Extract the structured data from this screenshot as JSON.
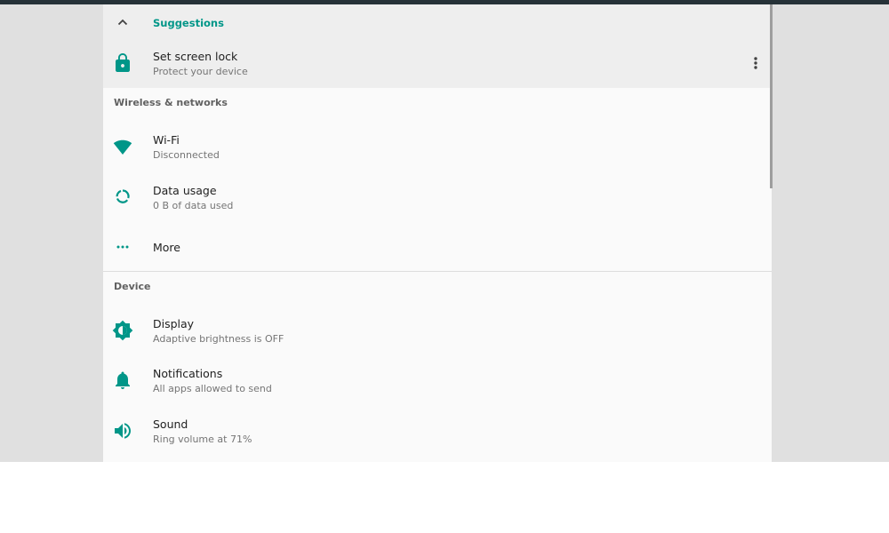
{
  "suggestions": {
    "header": "Suggestions",
    "collapse_icon": "chevron-up-icon",
    "item": {
      "icon": "lock-icon",
      "title": "Set screen lock",
      "subtitle": "Protect your device",
      "menu_icon": "more-vert-icon"
    }
  },
  "sections": {
    "wireless": {
      "title": "Wireless & networks",
      "items": [
        {
          "icon": "wifi-icon",
          "title": "Wi-Fi",
          "subtitle": "Disconnected"
        },
        {
          "icon": "data-usage-icon",
          "title": "Data usage",
          "subtitle": "0 B of data used"
        },
        {
          "icon": "more-horiz-icon",
          "title": "More"
        }
      ]
    },
    "device": {
      "title": "Device",
      "items": [
        {
          "icon": "brightness-icon",
          "title": "Display",
          "subtitle": "Adaptive brightness is OFF"
        },
        {
          "icon": "bell-icon",
          "title": "Notifications",
          "subtitle": "All apps allowed to send"
        },
        {
          "icon": "volume-icon",
          "title": "Sound",
          "subtitle": "Ring volume at 71%"
        }
      ]
    }
  },
  "colors": {
    "accent": "#009688",
    "panel": "#fafafa",
    "suggestion_bg": "#eeeeee",
    "backdrop": "#e0e0e0"
  }
}
